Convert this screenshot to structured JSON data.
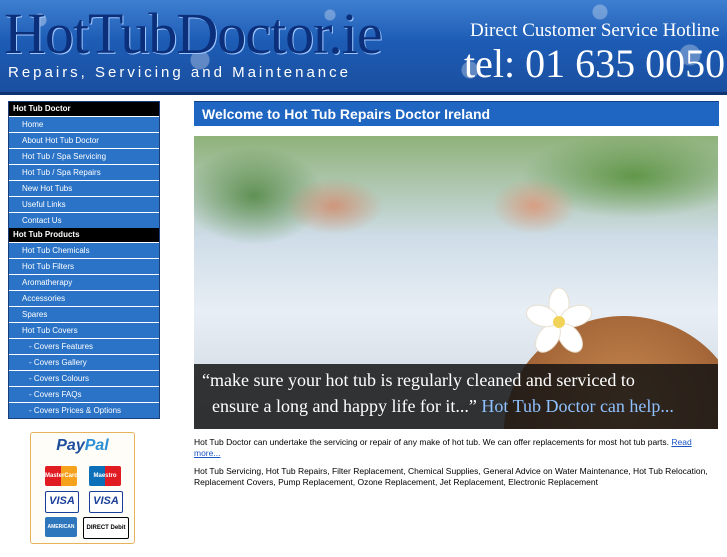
{
  "header": {
    "logo": "HotTubDoctor.ie",
    "tagline": "Repairs, Servicing and Maintenance",
    "hotline_label": "Direct Customer Service Hotline",
    "hotline_number": "tel: 01 635 0050"
  },
  "sidebar": {
    "section1": "Hot Tub Doctor",
    "items1": [
      "Home",
      "About Hot Tub Doctor",
      "Hot Tub / Spa Servicing",
      "Hot Tub / Spa Repairs",
      "New Hot Tubs",
      "Useful Links",
      "Contact Us"
    ],
    "section2": "Hot Tub Products",
    "items2": [
      "Hot Tub Chemicals",
      "Hot Tub Filters",
      "Aromatherapy",
      "Accessories",
      "Spares",
      "Hot Tub Covers"
    ],
    "subitems": [
      "- Covers Features",
      "- Covers Gallery",
      "- Covers Colours",
      "- Covers FAQs",
      "- Covers Prices & Options"
    ]
  },
  "payment": {
    "paypal_pay": "Pay",
    "paypal_pal": "Pal",
    "mastercard": "MasterCard",
    "maestro": "Maestro",
    "visa": "VISA",
    "visa_electron": "VISA",
    "amex": "AMERICAN EXPRESS",
    "direct_debit": "DIRECT Debit"
  },
  "main": {
    "title": "Welcome to Hot Tub Repairs Doctor Ireland",
    "caption_line1": "“make sure your hot tub is regularly cleaned and serviced to",
    "caption_line2": "ensure a long and happy life for it...”",
    "caption_highlight": " Hot Tub Doctor can help...",
    "intro": "Hot Tub Doctor can undertake the servicing or repair of any make of hot tub. We can offer replacements for most hot tub parts. ",
    "read_more": "Read more...",
    "services": "Hot Tub Servicing, Hot Tub Repairs, Filter Replacement, Chemical Supplies, General Advice on Water Maintenance, Hot Tub Relocation, Replacement Covers, Pump Replacement, Ozone Replacement, Jet Replacement, Electronic Replacement"
  },
  "colors": {
    "menu_blue": "#2a73c7",
    "title_blue": "#1f66c2",
    "link": "#1a55c4"
  }
}
